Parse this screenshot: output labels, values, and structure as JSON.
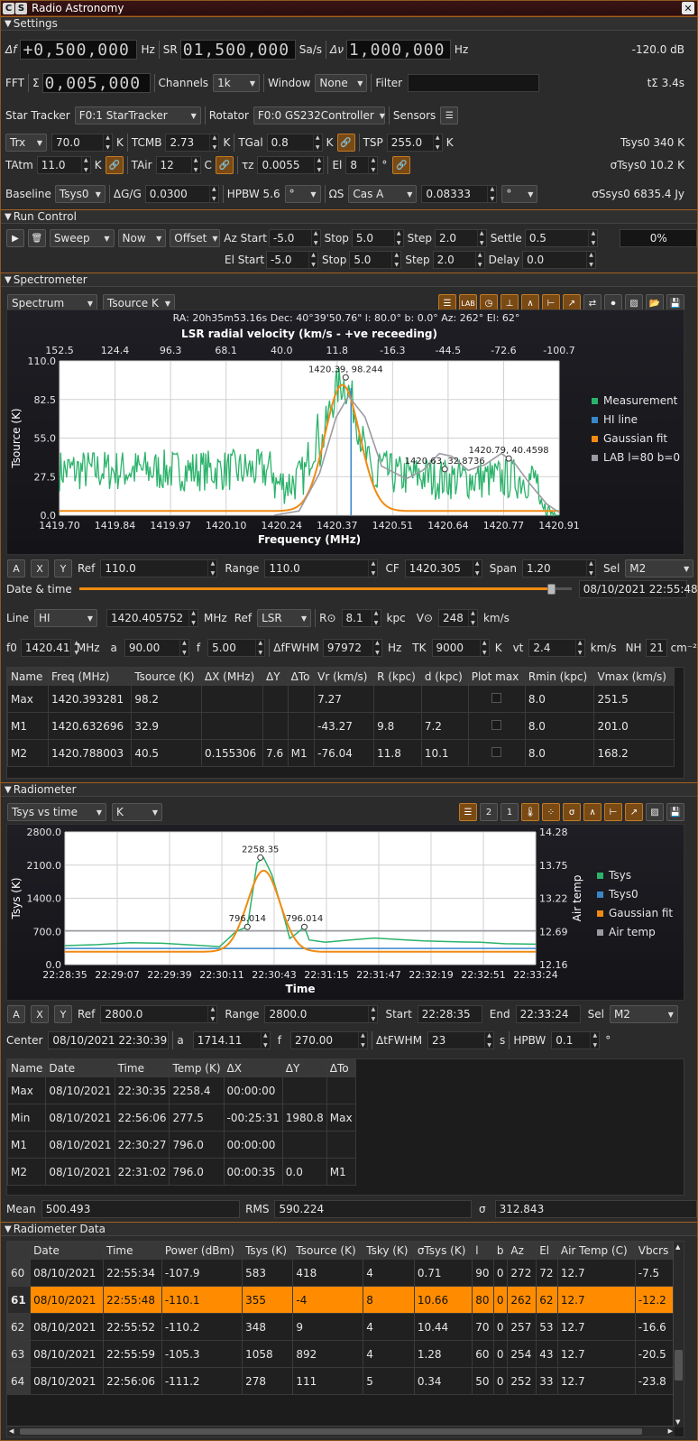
{
  "window": {
    "title": "Radio Astronomy",
    "badge1": "C",
    "badge2": "S"
  },
  "sections": {
    "settings": "Settings",
    "run": "Run Control",
    "spectrometer": "Spectrometer",
    "radiometer": "Radiometer",
    "data": "Radiometer Data"
  },
  "settings": {
    "df_label": "Δf",
    "df_value": "+0,500,000",
    "df_unit": "Hz",
    "sr_label": "SR",
    "sr_value": "01,500,000",
    "sr_unit": "Sa/s",
    "dv_label": "Δν",
    "dv_value": "1,000,000",
    "dv_unit": "Hz",
    "power": "-120.0  dB",
    "fft_label": "FFT",
    "sigma": "Σ",
    "fft_value": "0,005,000",
    "channels_label": "Channels",
    "channels": "1k",
    "window_label": "Window",
    "window": "None",
    "filter_label": "Filter",
    "filter": "",
    "tint": "tΣ 3.4s",
    "startracker_label": "Star Tracker",
    "startracker": "F0:1 StarTracker",
    "rotator_label": "Rotator",
    "rotator": "F0:0 GS232Controller",
    "sensors_label": "Sensors",
    "trx": "Trx",
    "trx_val": "70.0",
    "k1": "K",
    "tcmb_label": "TCMB",
    "tcmb": "2.73",
    "k2": "K",
    "tgal_label": "TGal",
    "tgal": "0.8",
    "k3": "K",
    "tsp_label": "TSP",
    "tsp": "255.0",
    "k4": "K",
    "tsys0": "Tsys0 340 K",
    "tatm_label": "TAtm",
    "tatm": "11.0",
    "k5": "K",
    "tair_label": "TAir",
    "tair": "12",
    "c": "C",
    "tau_label": "τz",
    "tau": "0.0055",
    "el_label": "El",
    "el": "8",
    "deg": "°",
    "sigmatsys": "σTsys0 10.2 K",
    "baseline_label": "Baseline",
    "baseline": "Tsys0",
    "dgg_label": "ΔG/G",
    "dgg": "0.0300",
    "hpbw_label": "HPBW 5.6",
    "hpbw_unit": "°",
    "omega_label": "ΩS",
    "omega_src": "Cas A",
    "omega_val": "0.08333",
    "omega_unit": "°",
    "sigmas": "σSsys0 6835.4 Jy"
  },
  "run": {
    "sweep": "Sweep",
    "now": "Now",
    "offset": "Offset",
    "az_start_label": "Az Start",
    "az_start": "-5.0",
    "az_stop_label": "Stop",
    "az_stop": "5.0",
    "az_step_label": "Step",
    "az_step": "2.0",
    "settle_label": "Settle",
    "settle": "0.5",
    "progress": "0%",
    "el_start_label": "El Start",
    "el_start": "-5.0",
    "el_stop_label": "Stop",
    "el_stop": "5.0",
    "el_step_label": "Step",
    "el_step": "2.0",
    "delay_label": "Delay",
    "delay": "0.0"
  },
  "spectrometer": {
    "mode": "Spectrum",
    "units": "Tsource K",
    "lab_btn": "LAB",
    "radec": "RA: 20h35m53.16s Dec: 40°39'50.76\" l: 80.0° b: 0.0° Az: 262° El: 62°",
    "axis_btns": {
      "a": "A",
      "x": "X",
      "y": "Y"
    },
    "ref_label": "Ref",
    "ref": "110.0",
    "range_label": "Range",
    "range": "110.0",
    "cf_label": "CF",
    "cf": "1420.305",
    "span_label": "Span",
    "span": "1.20",
    "sel_label": "Sel",
    "sel": "M2",
    "datetime_label": "Date & time",
    "datetime": "08/10/2021 22:55:48",
    "datetime_fraction": 0.96,
    "line_label": "Line",
    "line": "HI",
    "line_freq": "1420.405752",
    "mhz": "MHz",
    "ref2_label": "Ref",
    "ref2": "LSR",
    "r0_label": "R⊙",
    "r0": "8.1",
    "kpc": "kpc",
    "v0_label": "V⊙",
    "v0": "248",
    "kms": "km/s",
    "f0_label": "f0",
    "f0": "1420.41",
    "mhz2": "MHz",
    "a_label": "a",
    "a": "90.00",
    "f_label": "f",
    "f": "5.00",
    "dfwhm_label": "ΔfFWHM",
    "dfwhm": "97972",
    "hz": "Hz",
    "tk_label": "TK",
    "tk": "9000",
    "k": "K",
    "vt_label": "vt",
    "vt": "2.4",
    "kms2": "km/s",
    "nh_label": "NH",
    "nh": "21",
    "cm": "cm⁻²",
    "table_headers": [
      "Name",
      "Freq (MHz)",
      "Tsource (K)",
      "ΔX (MHz)",
      "ΔY",
      "ΔTo",
      "Vr (km/s)",
      "R (kpc)",
      "d (kpc)",
      "Plot max",
      "Rmin (kpc)",
      "Vmax (km/s)"
    ],
    "table_rows": [
      [
        "Max",
        "1420.393281",
        "98.2",
        "",
        "",
        "",
        "7.27",
        "",
        "",
        "",
        "8.0",
        "251.5"
      ],
      [
        "M1",
        "1420.632696",
        "32.9",
        "",
        "",
        "",
        "-43.27",
        "9.8",
        "7.2",
        "",
        "8.0",
        "201.0"
      ],
      [
        "M2",
        "1420.788003",
        "40.5",
        "0.155306",
        "7.6",
        "M1",
        "-76.04",
        "11.8",
        "10.1",
        "",
        "8.0",
        "168.2"
      ]
    ]
  },
  "spec_chart": {
    "type": "line",
    "title": "LSR radial velocity (km/s - +ve receeding)",
    "xlabel": "Frequency (MHz)",
    "ylabel": "Tsource (K)",
    "xlim": [
      1419.7,
      1420.91
    ],
    "ylim": [
      0,
      110
    ],
    "x_ticks": [
      "1419.70",
      "1419.84",
      "1419.97",
      "1420.10",
      "1420.24",
      "1420.37",
      "1420.51",
      "1420.64",
      "1420.77",
      "1420.91"
    ],
    "y_ticks": [
      "0.0",
      "27.5",
      "55.0",
      "82.5",
      "110.0"
    ],
    "top_ticks": [
      "152.5",
      "124.4",
      "96.3",
      "68.1",
      "40.0",
      "11.8",
      "-16.3",
      "-44.5",
      "-72.6",
      "-100.7"
    ],
    "legend": [
      "Measurement",
      "HI line",
      "Gaussian fit",
      "LAB l=80 b=0"
    ],
    "colors": {
      "measurement": "#2bb36b",
      "hi": "#3a86c8",
      "gauss": "#f08a12",
      "lab": "#9a9aa2"
    },
    "markers": [
      {
        "x": 1420.393,
        "y": 98.244,
        "label": "1420.39, 98.244"
      },
      {
        "x": 1420.633,
        "y": 32.8736,
        "label": "1420.63, 32.8736"
      },
      {
        "x": 1420.788,
        "y": 40.4598,
        "label": "1420.79, 40.4598"
      }
    ],
    "hi_line_x": 1420.406,
    "gauss": {
      "center": 1420.385,
      "amp": 90,
      "sigma": 0.042,
      "base": 3
    },
    "lab_points": [
      [
        1420.22,
        0
      ],
      [
        1420.28,
        3
      ],
      [
        1420.33,
        30
      ],
      [
        1420.37,
        70
      ],
      [
        1420.4,
        85
      ],
      [
        1420.44,
        70
      ],
      [
        1420.48,
        35
      ],
      [
        1420.54,
        26
      ],
      [
        1420.58,
        32
      ],
      [
        1420.62,
        44
      ],
      [
        1420.65,
        42
      ],
      [
        1420.69,
        32
      ],
      [
        1420.73,
        36
      ],
      [
        1420.77,
        44
      ],
      [
        1420.8,
        38
      ],
      [
        1420.84,
        22
      ],
      [
        1420.88,
        8
      ],
      [
        1420.91,
        2
      ]
    ]
  },
  "radiometer": {
    "mode": "Tsys vs time",
    "units": "K",
    "ref_label": "Ref",
    "ref": "2800.0",
    "range_label": "Range",
    "range": "2800.0",
    "start_label": "Start",
    "start": "22:28:35",
    "end_label": "End",
    "end": "22:33:24",
    "sel_label": "Sel",
    "sel": "M2",
    "axis_btns": {
      "a": "A",
      "x": "X",
      "y": "Y"
    },
    "center_label": "Center",
    "center": "08/10/2021 22:30:39",
    "a_label": "a",
    "a": "1714.11",
    "f_label": "f",
    "f": "270.00",
    "dt_label": "ΔtFWHM",
    "dt": "23",
    "s": "s",
    "hpbw_label": "HPBW",
    "hpbw": "0.1",
    "deg": "°",
    "table_headers": [
      "Name",
      "Date",
      "Time",
      "Temp (K)",
      "ΔX",
      "ΔY",
      "ΔTo"
    ],
    "table_rows": [
      [
        "Max",
        "08/10/2021",
        "22:30:35",
        "2258.4",
        "00:00:00",
        "",
        ""
      ],
      [
        "Min",
        "08/10/2021",
        "22:56:06",
        "277.5",
        "-00:25:31",
        "1980.8",
        "Max"
      ],
      [
        "M1",
        "08/10/2021",
        "22:30:27",
        "796.0",
        "00:00:00",
        "",
        ""
      ],
      [
        "M2",
        "08/10/2021",
        "22:31:02",
        "796.0",
        "00:00:35",
        "0.0",
        "M1"
      ]
    ],
    "mean_label": "Mean",
    "mean": "500.493",
    "rms_label": "RMS",
    "rms": "590.224",
    "sigma_label": "σ",
    "sigma": "312.843"
  },
  "rad_chart": {
    "type": "line",
    "xlabel": "Time",
    "ylabel": "Tsys (K)",
    "y2label": "Air temp",
    "ylim": [
      0,
      2800
    ],
    "y2lim": [
      12.16,
      14.28
    ],
    "x_ticks": [
      "22:28:35",
      "22:29:07",
      "22:29:39",
      "22:30:11",
      "22:30:43",
      "22:31:15",
      "22:31:47",
      "22:32:19",
      "22:32:51",
      "22:33:24"
    ],
    "y_ticks": [
      "0.0",
      "700.0",
      "1400.0",
      "2100.0",
      "2800.0"
    ],
    "y2_ticks": [
      "12.16",
      "12.69",
      "13.22",
      "13.75",
      "14.28"
    ],
    "legend": [
      "Tsys",
      "Tsys0",
      "Gaussian fit",
      "Air temp"
    ],
    "colors": {
      "tsys": "#2bb36b",
      "tsys0": "#3a86c8",
      "gauss": "#f08a12",
      "air": "#9a9aa2"
    },
    "markers": [
      {
        "t": 120,
        "y": 2258.35,
        "label": "2258.35"
      },
      {
        "t": 112,
        "y": 796.014,
        "label": "796.014"
      },
      {
        "t": 147,
        "y": 796.014,
        "label": "796.014"
      }
    ],
    "tsys_points": [
      [
        0,
        400
      ],
      [
        20,
        420
      ],
      [
        40,
        460
      ],
      [
        60,
        450
      ],
      [
        80,
        410
      ],
      [
        95,
        380
      ],
      [
        105,
        700
      ],
      [
        112,
        796
      ],
      [
        118,
        2150
      ],
      [
        122,
        2258
      ],
      [
        127,
        1900
      ],
      [
        133,
        1200
      ],
      [
        138,
        550
      ],
      [
        142,
        650
      ],
      [
        147,
        796
      ],
      [
        150,
        520
      ],
      [
        160,
        470
      ],
      [
        175,
        520
      ],
      [
        190,
        560
      ],
      [
        205,
        530
      ],
      [
        220,
        500
      ],
      [
        240,
        480
      ],
      [
        255,
        470
      ],
      [
        270,
        440
      ],
      [
        289,
        430
      ]
    ],
    "tsys0_value": 340,
    "gauss": {
      "center": 122,
      "amp": 1714,
      "sigma": 10,
      "base": 270
    },
    "air_value": 12.7
  },
  "data": {
    "headers": [
      "",
      "Date",
      "Time",
      "Power (dBm)",
      "Tsys (K)",
      "Tsource (K)",
      "Tsky (K)",
      "σTsys (K)",
      "l",
      "b",
      "Az",
      "El",
      "Air Temp (C)",
      "Vbcrs"
    ],
    "rows": [
      [
        "60",
        "08/10/2021",
        "22:55:34",
        "-107.9",
        "583",
        "418",
        "4",
        "0.71",
        "90",
        "0",
        "272",
        "72",
        "12.7",
        "-7.5"
      ],
      [
        "61",
        "08/10/2021",
        "22:55:48",
        "-110.1",
        "355",
        "-4",
        "8",
        "10.66",
        "80",
        "0",
        "262",
        "62",
        "12.7",
        "-12.2"
      ],
      [
        "62",
        "08/10/2021",
        "22:55:52",
        "-110.2",
        "348",
        "9",
        "4",
        "10.44",
        "70",
        "0",
        "257",
        "53",
        "12.7",
        "-16.6"
      ],
      [
        "63",
        "08/10/2021",
        "22:55:59",
        "-105.3",
        "1058",
        "892",
        "4",
        "1.28",
        "60",
        "0",
        "254",
        "43",
        "12.7",
        "-20.5"
      ],
      [
        "64",
        "08/10/2021",
        "22:56:06",
        "-111.2",
        "278",
        "111",
        "5",
        "0.34",
        "50",
        "0",
        "252",
        "33",
        "12.7",
        "-23.8"
      ]
    ],
    "selected_row": 1,
    "highlight": "#ff8c00"
  }
}
